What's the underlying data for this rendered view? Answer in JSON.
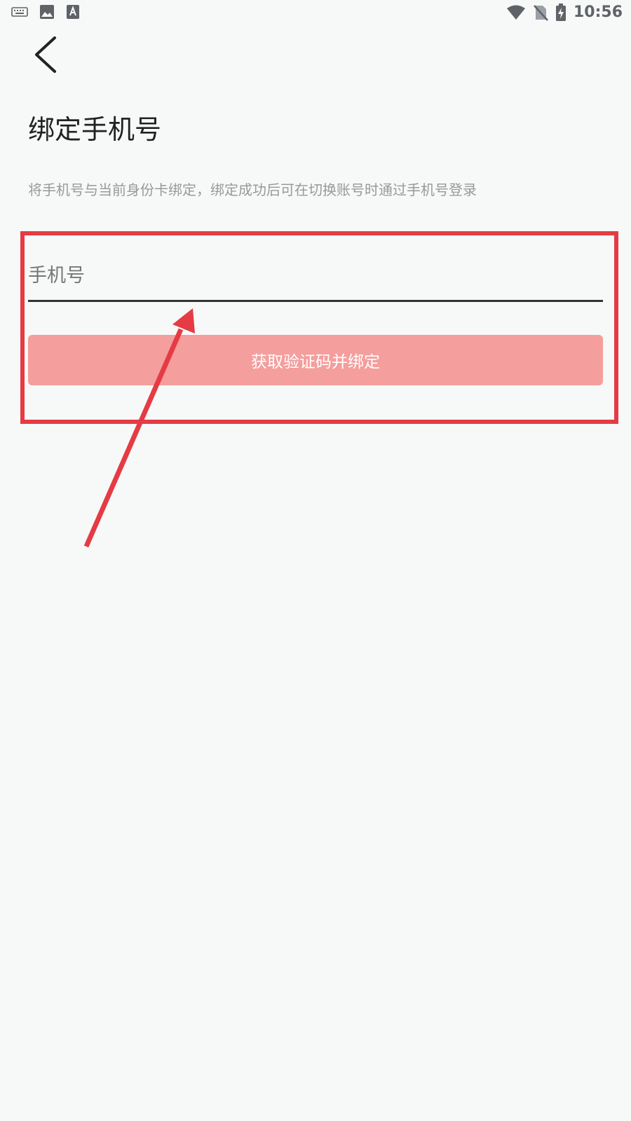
{
  "status_bar": {
    "time": "10:56",
    "left_icons": [
      "keyboard-icon",
      "image-icon",
      "font-icon"
    ],
    "right_icons": [
      "wifi-icon",
      "no-sim-icon",
      "battery-charging-icon"
    ]
  },
  "header": {
    "back_icon": "chevron-left-icon"
  },
  "main": {
    "title": "绑定手机号",
    "description": "将手机号与当前身份卡绑定，绑定成功后可在切换账号时通过手机号登录",
    "phone_input": {
      "placeholder": "手机号",
      "value": ""
    },
    "bind_button_label": "获取验证码并绑定"
  },
  "colors": {
    "background": "#f7f8f8",
    "button": "#f49e9d",
    "annotation": "#e53b44",
    "title": "#222222",
    "description": "#999999"
  }
}
